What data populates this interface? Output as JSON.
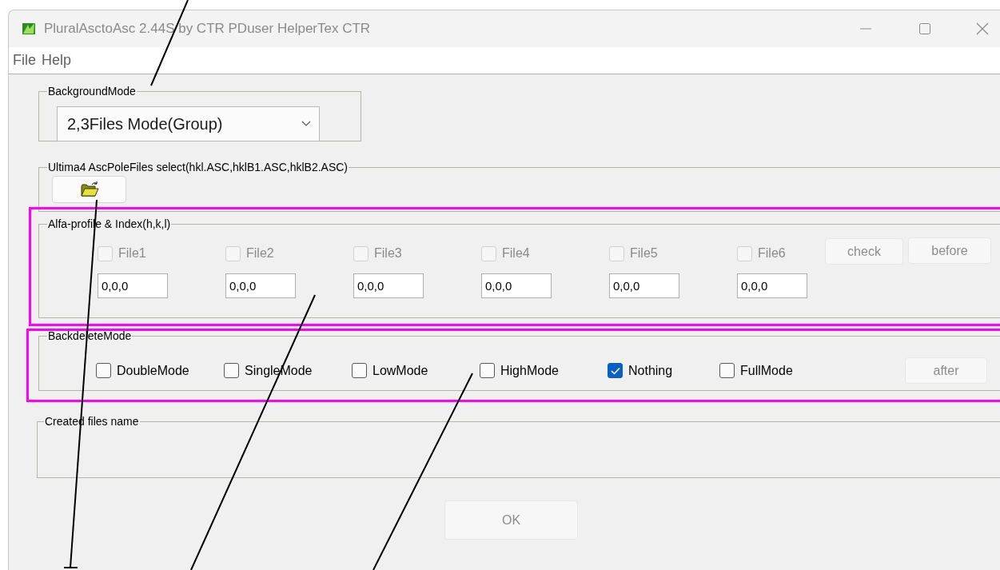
{
  "window": {
    "title": "PluralAsctoAsc 2.44S by CTR PDuser HelperTex CTR"
  },
  "menu": [
    {
      "label": "File"
    },
    {
      "label": "Help"
    }
  ],
  "background_mode": {
    "label": "BackgroundMode",
    "value": "2,3Files Mode(Group)"
  },
  "pole_files": {
    "label": "Ultima4 AscPoleFiles select(hkl.ASC,hklB1.ASC,hklB2.ASC)"
  },
  "alfa": {
    "label": "Alfa-profile & Index(h,k,l)",
    "files": [
      {
        "label": "File1",
        "checked": false,
        "disabled": true,
        "value": "0,0,0"
      },
      {
        "label": "File2",
        "checked": false,
        "disabled": true,
        "value": "0,0,0"
      },
      {
        "label": "File3",
        "checked": false,
        "disabled": true,
        "value": "0,0,0"
      },
      {
        "label": "File4",
        "checked": false,
        "disabled": true,
        "value": "0,0,0"
      },
      {
        "label": "File5",
        "checked": false,
        "disabled": true,
        "value": "0,0,0"
      },
      {
        "label": "File6",
        "checked": false,
        "disabled": true,
        "value": "0,0,0"
      }
    ],
    "buttons": [
      {
        "label": "check",
        "disabled": true
      },
      {
        "label": "before",
        "disabled": true
      }
    ]
  },
  "backdelete": {
    "label": "BackdeleteMode",
    "modes": [
      {
        "label": "DoubleMode",
        "checked": false
      },
      {
        "label": "SingleMode",
        "checked": false
      },
      {
        "label": "LowMode",
        "checked": false
      },
      {
        "label": "HighMode",
        "checked": false
      },
      {
        "label": "Nothing",
        "checked": true
      },
      {
        "label": "FullMode",
        "checked": false
      }
    ],
    "after_button": {
      "label": "after",
      "disabled": true
    }
  },
  "created_files": {
    "label": "Created files name"
  },
  "ok_button": {
    "label": "OK",
    "disabled": true
  }
}
